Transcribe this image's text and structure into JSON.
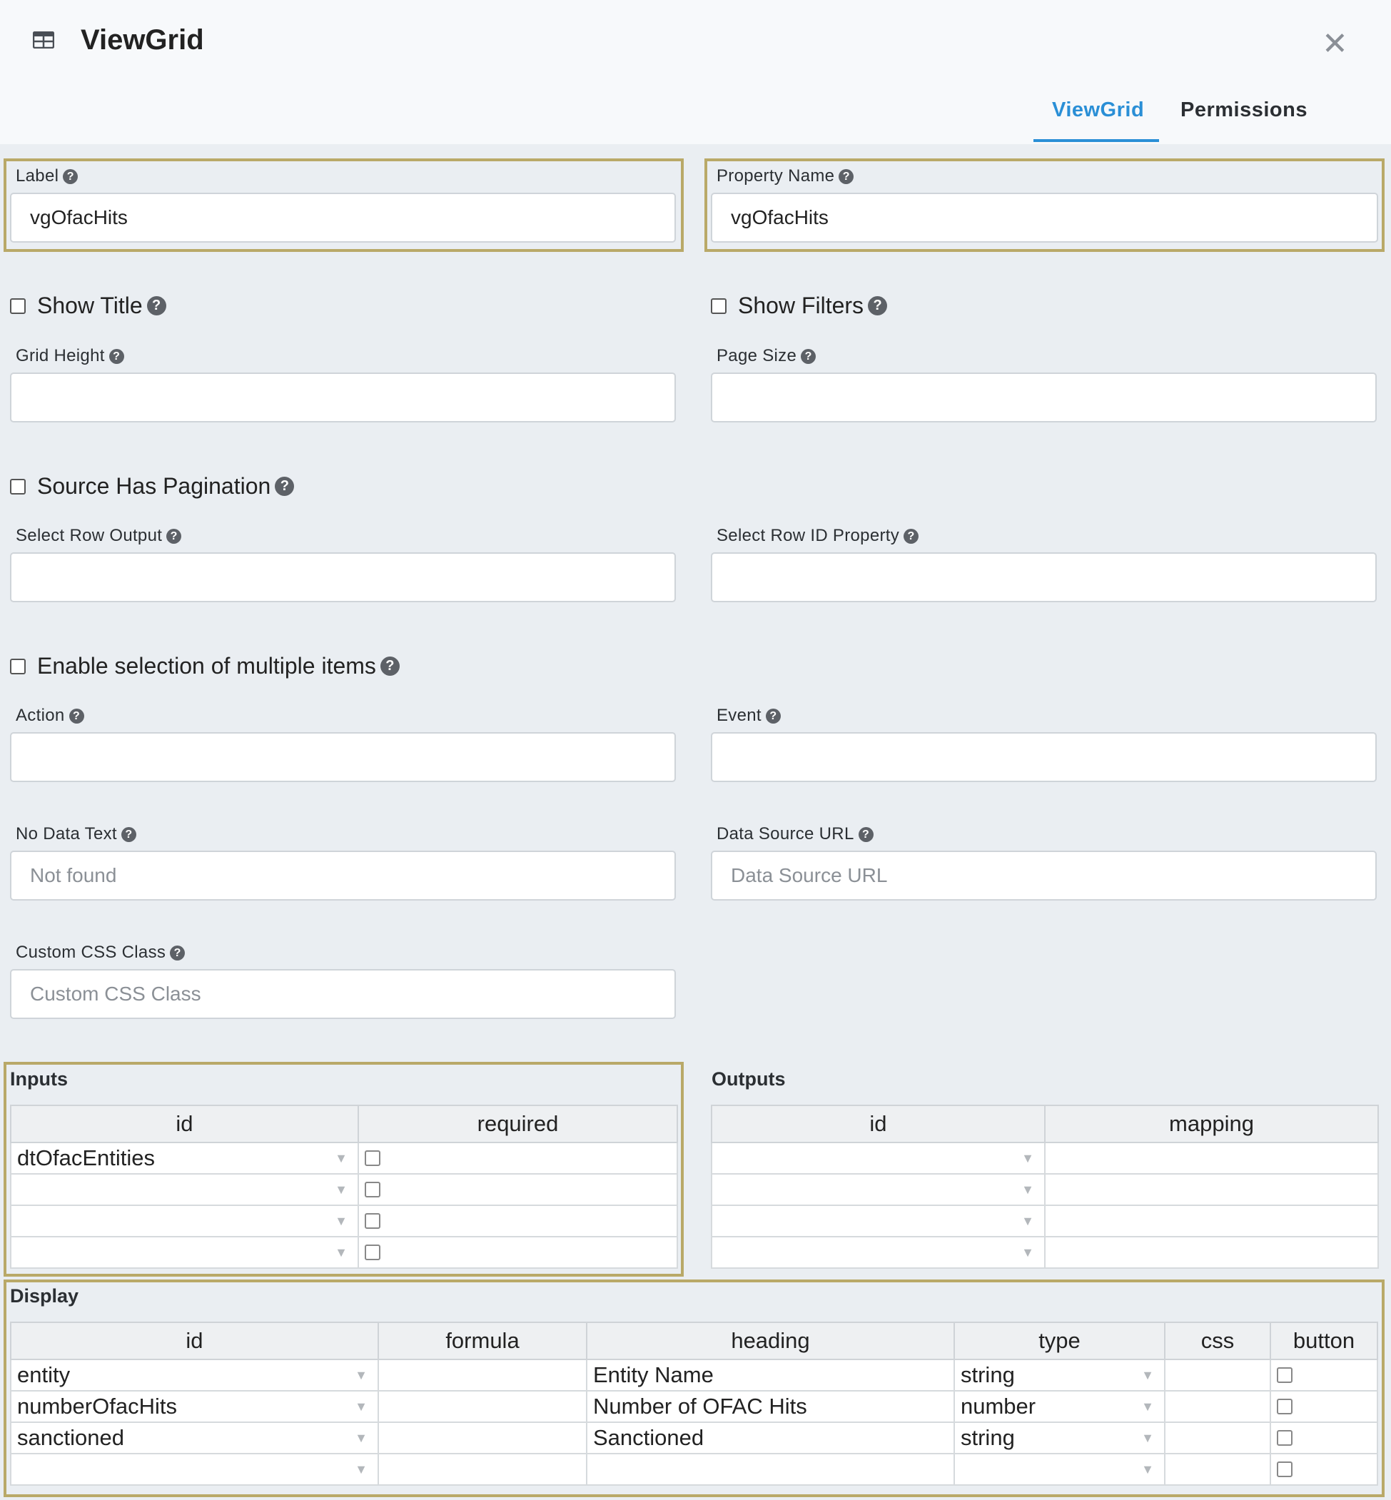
{
  "dialog": {
    "icon": "table-grid-icon",
    "title": "ViewGrid",
    "close_icon": "close-icon",
    "tabs": [
      {
        "label": "ViewGrid",
        "active": true
      },
      {
        "label": "Permissions",
        "active": false
      }
    ]
  },
  "fields": {
    "label": {
      "label": "Label",
      "value": "vgOfacHits"
    },
    "property_name": {
      "label": "Property Name",
      "value": "vgOfacHits"
    },
    "show_title": {
      "label": "Show Title",
      "checked": false
    },
    "show_filters": {
      "label": "Show Filters",
      "checked": false
    },
    "grid_height": {
      "label": "Grid Height",
      "value": ""
    },
    "page_size": {
      "label": "Page Size",
      "value": ""
    },
    "source_has_pagination": {
      "label": "Source Has Pagination",
      "checked": false
    },
    "select_row_output": {
      "label": "Select Row Output",
      "value": ""
    },
    "select_row_id_property": {
      "label": "Select Row ID Property",
      "value": ""
    },
    "enable_multi_select": {
      "label": "Enable selection of multiple items",
      "checked": false
    },
    "action": {
      "label": "Action",
      "value": ""
    },
    "event": {
      "label": "Event",
      "value": ""
    },
    "no_data_text": {
      "label": "No Data Text",
      "placeholder": "Not found"
    },
    "data_source_url": {
      "label": "Data Source URL",
      "placeholder": "Data Source URL"
    },
    "custom_css_class": {
      "label": "Custom CSS Class",
      "placeholder": "Custom CSS Class"
    }
  },
  "inputs": {
    "title": "Inputs",
    "columns": [
      "id",
      "required"
    ],
    "rows": [
      {
        "id": "dtOfacEntities",
        "required": false
      },
      {
        "id": "",
        "required": false
      },
      {
        "id": "",
        "required": false
      },
      {
        "id": "",
        "required": false
      }
    ]
  },
  "outputs": {
    "title": "Outputs",
    "columns": [
      "id",
      "mapping"
    ],
    "rows": [
      {
        "id": "",
        "mapping": ""
      },
      {
        "id": "",
        "mapping": ""
      },
      {
        "id": "",
        "mapping": ""
      },
      {
        "id": "",
        "mapping": ""
      }
    ]
  },
  "display": {
    "title": "Display",
    "columns": [
      "id",
      "formula",
      "heading",
      "type",
      "css",
      "button"
    ],
    "rows": [
      {
        "id": "entity",
        "formula": "",
        "heading": "Entity Name",
        "type": "string",
        "css": "",
        "button": false
      },
      {
        "id": "numberOfacHits",
        "formula": "",
        "heading": "Number of OFAC Hits",
        "type": "number",
        "css": "",
        "button": false
      },
      {
        "id": "sanctioned",
        "formula": "",
        "heading": "Sanctioned",
        "type": "string",
        "css": "",
        "button": false
      },
      {
        "id": "",
        "formula": "",
        "heading": "",
        "type": "",
        "css": "",
        "button": false
      }
    ]
  },
  "colors": {
    "accent": "#2a8fd6",
    "highlight_border": "#b9a968"
  }
}
